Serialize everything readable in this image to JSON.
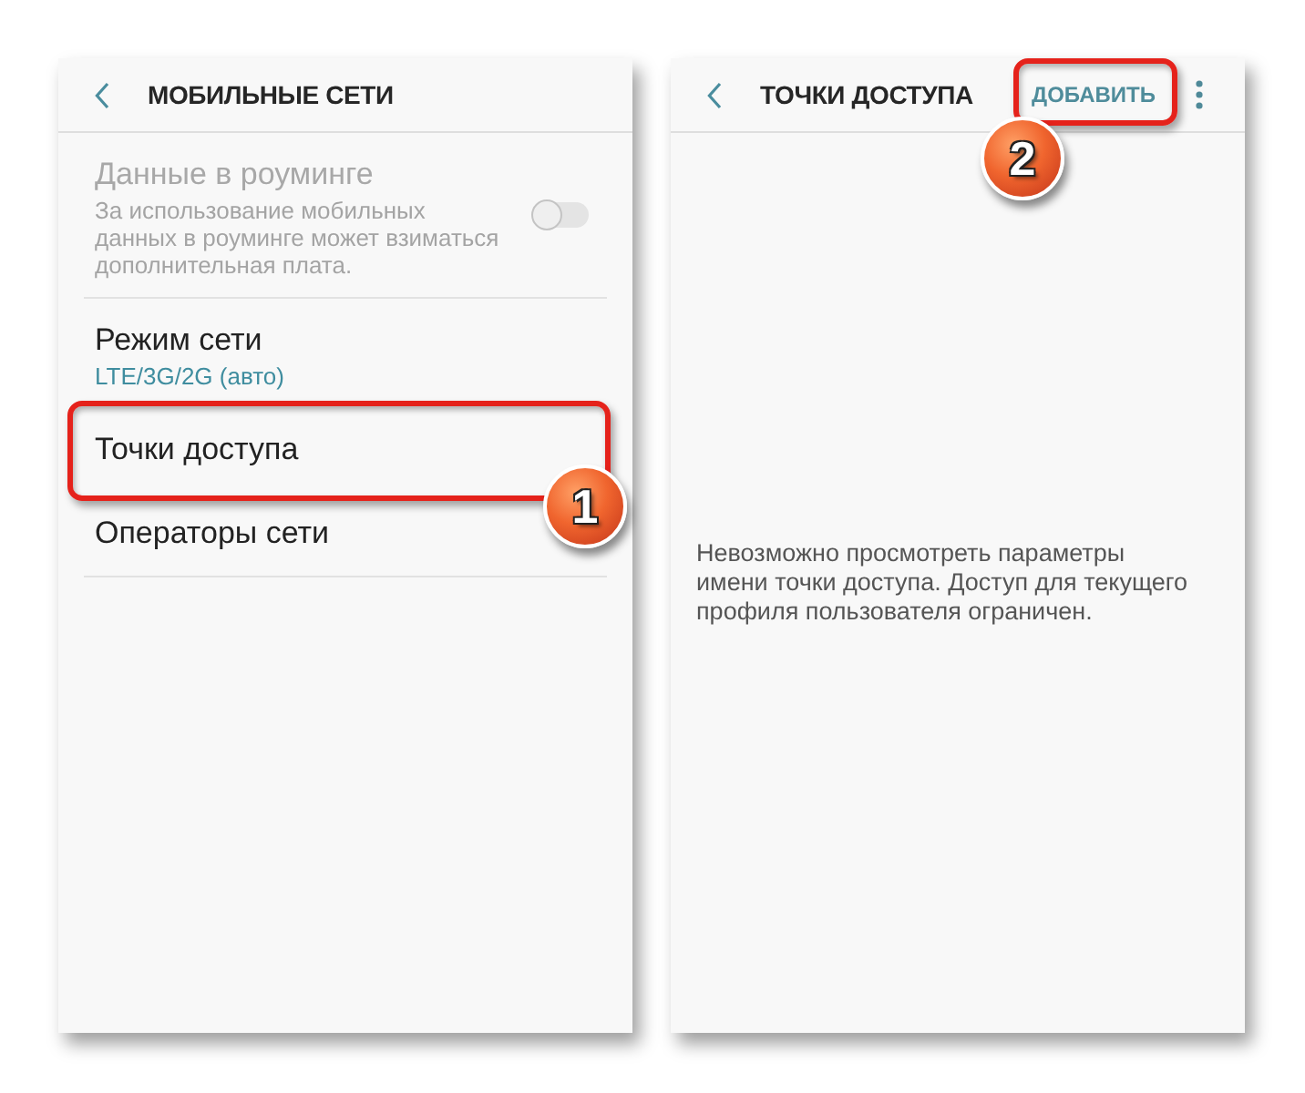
{
  "screens": [
    {
      "title": "МОБИЛЬНЫЕ СЕТИ",
      "sections": [
        {
          "items": [
            {
              "kind": "toggle",
              "title": "Данные в роуминге",
              "subtitle": "За использование мобильных данных в роуминге может взиматься дополнительная плата.",
              "disabled": true,
              "on": false,
              "highlighted": false
            }
          ]
        },
        {
          "items": [
            {
              "kind": "text",
              "title": "Режим сети",
              "subtitle": "LTE/3G/2G (авто)",
              "disabled": false,
              "highlighted": false
            },
            {
              "kind": "text",
              "title": "Точки доступа",
              "disabled": false,
              "highlighted": true,
              "step": "1"
            },
            {
              "kind": "text",
              "title": "Операторы сети",
              "disabled": false,
              "highlighted": false
            }
          ]
        }
      ]
    },
    {
      "title": "ТОЧКИ ДОСТУПА",
      "action": {
        "label": "ДОБАВИТЬ",
        "highlighted": true,
        "step": "2"
      },
      "more_menu": true,
      "message": "Невозможно просмотреть параметры имени точки доступа. Доступ для текущего профиля пользователя ограничен."
    }
  ]
}
